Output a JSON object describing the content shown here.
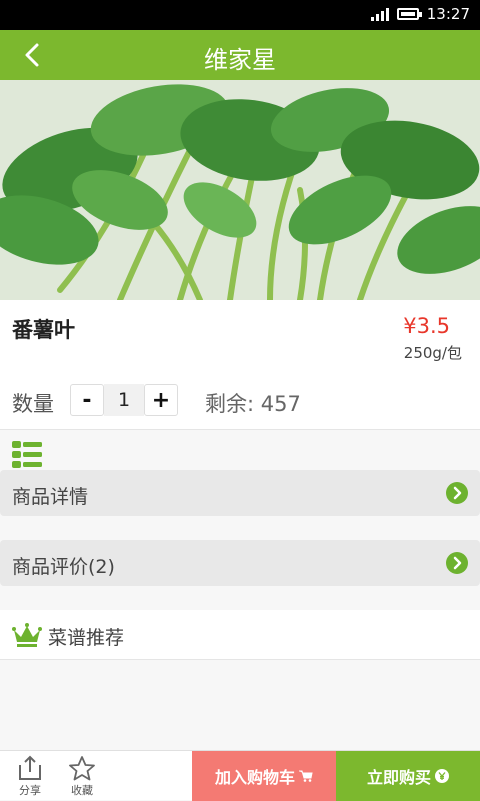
{
  "status": {
    "time": "13:27"
  },
  "nav": {
    "title": "维家星"
  },
  "product": {
    "name": "番薯叶",
    "price": "¥3.5",
    "unit": "250g/包",
    "qty_label": "数量",
    "qty_minus": "-",
    "qty_value": "1",
    "qty_plus": "+",
    "stock": "剩余: 457"
  },
  "sections": {
    "details": "商品详情",
    "reviews": "商品评价(2)",
    "recipes": "菜谱推荐"
  },
  "bottom": {
    "share": "分享",
    "favorite": "收藏",
    "add_cart": "加入购物车",
    "buy_now": "立即购买"
  },
  "colors": {
    "brand": "#7cb82e",
    "price": "#e8362a",
    "cart_button": "#f47a73"
  },
  "icons": [
    "back-arrow-icon",
    "signal-icon",
    "battery-icon",
    "list-icon",
    "chevron-right-icon",
    "crown-icon",
    "share-icon",
    "star-icon",
    "cart-icon",
    "yen-circle-icon"
  ]
}
